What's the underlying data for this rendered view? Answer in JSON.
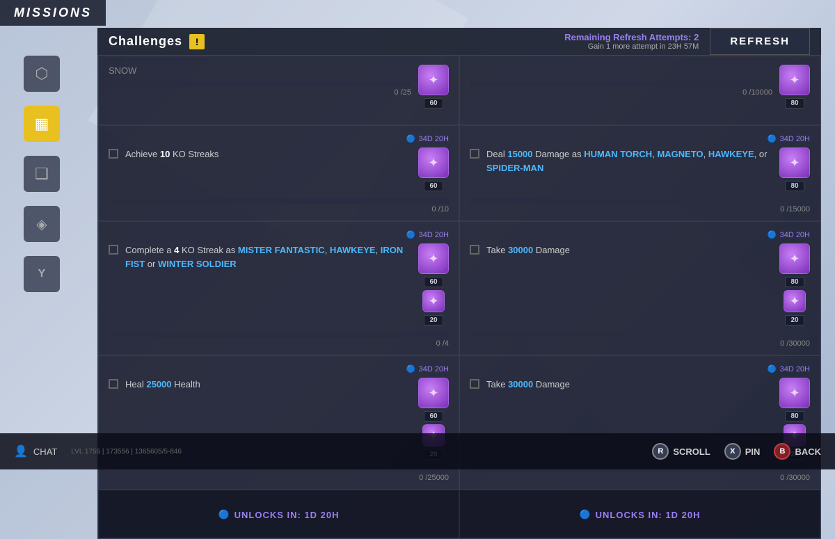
{
  "titleBar": {
    "title": "MISSIONS"
  },
  "sidebar": {
    "items": [
      {
        "id": "cube-icon",
        "label": "Cube",
        "active": false,
        "icon": "⬡"
      },
      {
        "id": "calendar-icon",
        "label": "Calendar",
        "active": true,
        "icon": "▦"
      },
      {
        "id": "card-icon",
        "label": "Card",
        "active": false,
        "icon": "❑"
      },
      {
        "id": "shield-icon",
        "label": "Shield",
        "active": false,
        "icon": "◈"
      },
      {
        "id": "y-icon",
        "label": "Y",
        "active": false,
        "icon": "Y"
      }
    ]
  },
  "header": {
    "title": "Challenges",
    "exclaim": "!",
    "refreshAttempts": "Remaining Refresh Attempts: 2",
    "refreshTimer": "Gain 1 more attempt in 23H 57M",
    "refreshBtn": "REFRESH"
  },
  "challenges": {
    "rows": [
      {
        "cells": [
          {
            "type": "partial",
            "timer": "",
            "text": "SNOW",
            "progress": "0/25",
            "progressPct": 0,
            "reward": "60"
          },
          {
            "type": "partial",
            "timer": "",
            "text": "",
            "progress": "0/10000",
            "progressPct": 0,
            "reward": "80"
          }
        ]
      },
      {
        "cells": [
          {
            "type": "challenge",
            "timer": "34D 20H",
            "text": "Achieve {10} KO Streaks",
            "textParts": [
              {
                "t": "Achieve ",
                "highlight": false
              },
              {
                "t": "10",
                "highlight": false,
                "bold": true
              },
              {
                "t": " KO Streaks",
                "highlight": false
              }
            ],
            "progress": "0/10",
            "progressPct": 0,
            "reward": "60"
          },
          {
            "type": "challenge",
            "timer": "34D 20H",
            "text": "Deal 15000 Damage as HUMAN TORCH, MAGNETO, HAWKEYE, or SPIDER-MAN",
            "textParts": [
              {
                "t": "Deal ",
                "highlight": false
              },
              {
                "t": "15000",
                "highlight": true
              },
              {
                "t": " Damage as ",
                "highlight": false
              },
              {
                "t": "HUMAN TORCH",
                "highlight": true
              },
              {
                "t": ", ",
                "highlight": false
              },
              {
                "t": "MAGNETO",
                "highlight": true
              },
              {
                "t": ", ",
                "highlight": false
              },
              {
                "t": "HAWKEYE",
                "highlight": true
              },
              {
                "t": ", or",
                "highlight": false
              }
            ],
            "textLine2Parts": [
              {
                "t": "SPIDER-MAN",
                "highlight": true
              }
            ],
            "progress": "0/15000",
            "progressPct": 0,
            "reward": "80"
          }
        ]
      },
      {
        "cells": [
          {
            "type": "challenge",
            "timer": "34D 20H",
            "text": "Complete a 4 KO Streak as MISTER FANTASTIC, HAWKEYE, IRON FIST or WINTER SOLDIER",
            "textParts": [
              {
                "t": "Complete a ",
                "highlight": false
              },
              {
                "t": "4",
                "highlight": false,
                "bold": true
              },
              {
                "t": " KO Streak as ",
                "highlight": false
              },
              {
                "t": "MISTER FANTASTIC",
                "highlight": true
              },
              {
                "t": ", ",
                "highlight": false
              },
              {
                "t": "HAWKEYE",
                "highlight": true
              },
              {
                "t": ", ",
                "highlight": false
              },
              {
                "t": "IRON FIST",
                "highlight": true
              },
              {
                "t": " or ",
                "highlight": false
              },
              {
                "t": "WINTER SOLDIER",
                "highlight": true
              }
            ],
            "progress": "0/4",
            "progressPct": 0,
            "reward": "60",
            "reward2": "20"
          },
          {
            "type": "challenge",
            "timer": "34D 20H",
            "text": "Take 30000 Damage",
            "textParts": [
              {
                "t": "Take ",
                "highlight": false
              },
              {
                "t": "30000",
                "highlight": true
              },
              {
                "t": " Damage",
                "highlight": false
              }
            ],
            "progress": "0/30000",
            "progressPct": 0,
            "reward": "80",
            "reward2": "20"
          }
        ]
      },
      {
        "cells": [
          {
            "type": "challenge",
            "timer": "34D 20H",
            "text": "Heal 25000 Health",
            "textParts": [
              {
                "t": "Heal ",
                "highlight": false
              },
              {
                "t": "25000",
                "highlight": true
              },
              {
                "t": " Health",
                "highlight": false
              }
            ],
            "progress": "0/25000",
            "progressPct": 0,
            "reward": "60",
            "reward2": "20"
          },
          {
            "type": "challenge",
            "timer": "34D 20H",
            "text": "Take 30000 Damage",
            "textParts": [
              {
                "t": "Take ",
                "highlight": false
              },
              {
                "t": "30000",
                "highlight": true
              },
              {
                "t": " Damage",
                "highlight": false
              }
            ],
            "progress": "0/30000",
            "progressPct": 0,
            "reward": "80",
            "reward2": "20"
          }
        ]
      },
      {
        "cells": [
          {
            "type": "unlock",
            "unlockText": "UNLOCKS IN: 1D 20H"
          },
          {
            "type": "unlock",
            "unlockText": "UNLOCKS IN: 1D 20H"
          }
        ]
      }
    ]
  },
  "bottomBar": {
    "chatLabel": "CHAT",
    "controls": [
      {
        "btn": "R",
        "label": "SCROLL"
      },
      {
        "btn": "X",
        "label": "PIN"
      },
      {
        "btn": "B",
        "label": "BACK"
      }
    ],
    "info": "LVL 1756 | 173556 | 1365605/5-846"
  }
}
